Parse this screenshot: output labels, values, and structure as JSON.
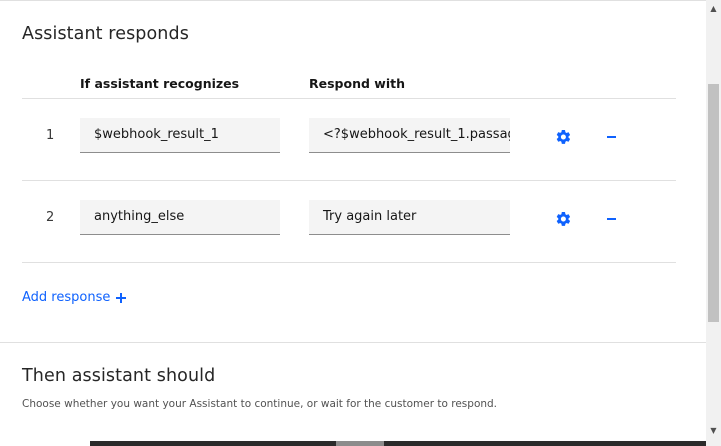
{
  "section1": {
    "title": "Assistant responds"
  },
  "columns": {
    "recognizes": "If assistant recognizes",
    "respond": "Respond with"
  },
  "rows": [
    {
      "num": "1",
      "condition": "$webhook_result_1",
      "response": "<?$webhook_result_1.passag"
    },
    {
      "num": "2",
      "condition": "anything_else",
      "response": "Try again later"
    }
  ],
  "add_response": {
    "label": "Add response"
  },
  "section2": {
    "title": "Then assistant should",
    "helper": "Choose whether you want your Assistant to continue, or wait for the customer to respond."
  },
  "colors": {
    "accent": "#0f62fe",
    "field_bg": "#f4f4f4",
    "divider": "#e0e0e0"
  },
  "icons": {
    "settings": "gear-icon",
    "remove": "minus-icon",
    "add": "plus-icon"
  }
}
